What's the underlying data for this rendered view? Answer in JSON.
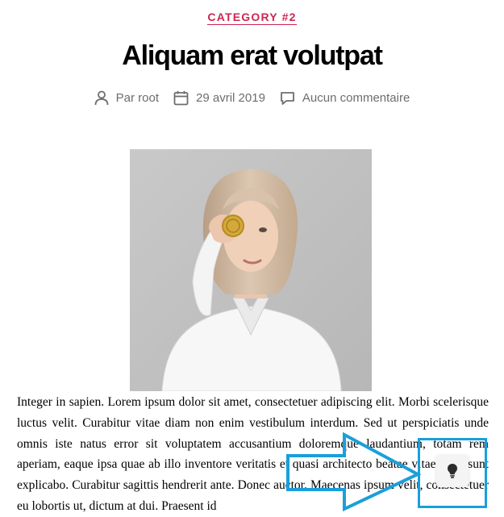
{
  "post": {
    "category": "CATEGORY #2",
    "title": "Aliquam erat volutpat",
    "meta": {
      "author": "Par root",
      "date": "29 avril 2019",
      "comments": "Aucun commentaire"
    },
    "body": "Integer in sapien. Lorem ipsum dolor sit amet, consectetuer adipiscing elit. Morbi scelerisque luctus velit. Curabitur vitae diam non enim vestibulum interdum. Sed ut perspiciatis unde omnis iste natus error sit voluptatem accusantium doloremque laudantium, totam rem aperiam, eaque ipsa quae ab illo inventore veritatis et quasi architecto beatae vitae dicta sunt explicabo. Curabitur sagittis hendrerit ante. Donec auctor. Maecenas ipsum velit, consectetuer eu lobortis ut, dictum at dui. Praesent id"
  },
  "colors": {
    "accent": "#cd2653",
    "meta_text": "#6d6d6d",
    "overlay_blue": "#1a9fdb"
  },
  "icons": {
    "author": "person-icon",
    "date": "calendar-icon",
    "comments": "comment-icon",
    "hint": "lightbulb-icon",
    "overlay": "arrow-right-icon"
  }
}
